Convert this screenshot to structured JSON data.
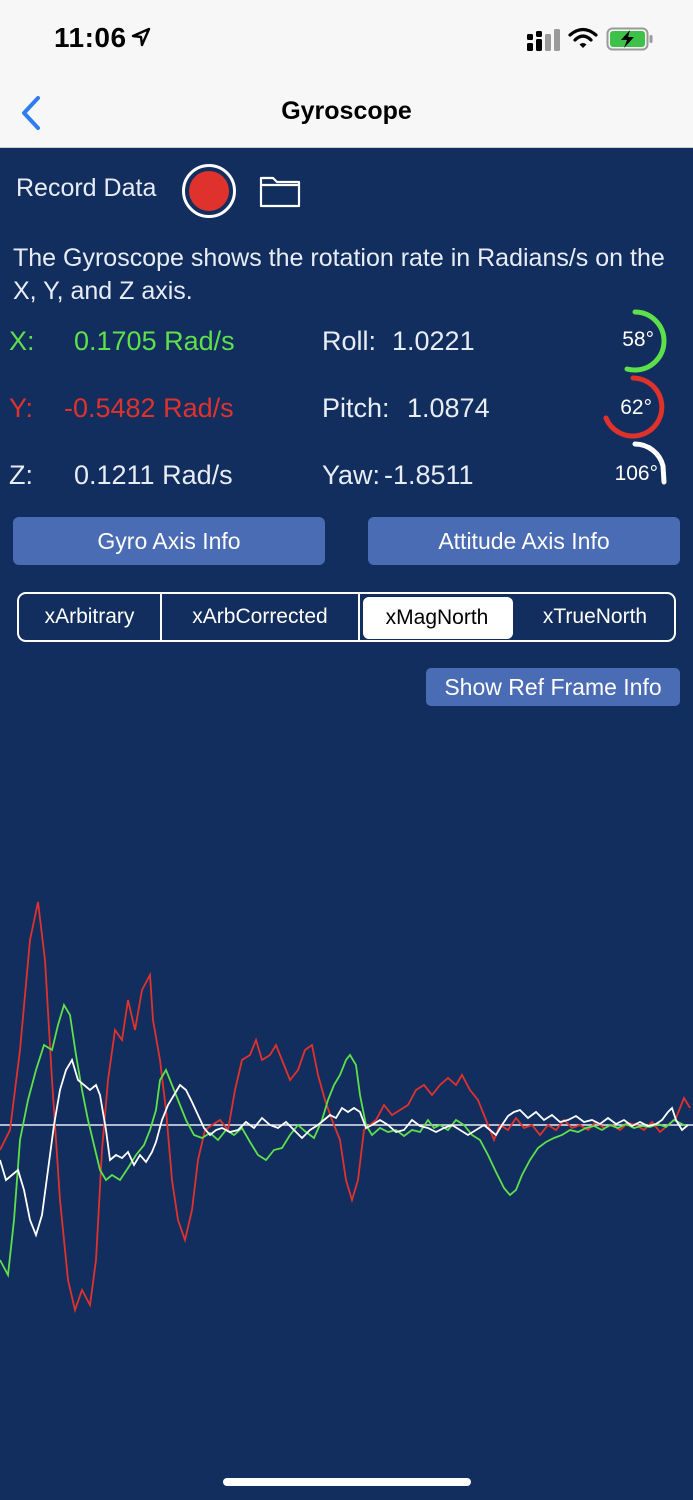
{
  "status": {
    "time": "11:06"
  },
  "nav": {
    "title": "Gyroscope"
  },
  "record": {
    "label": "Record Data"
  },
  "description": "The Gyroscope shows the rotation rate in Radians/s on the X, Y, and Z axis.",
  "rates": {
    "x": {
      "label": "X:",
      "value": "0.1705 Rad/s"
    },
    "y": {
      "label": "Y:",
      "value": "-0.5482 Rad/s"
    },
    "z": {
      "label": "Z:",
      "value": "0.1211 Rad/s"
    }
  },
  "attitude": {
    "roll": {
      "label": "Roll:",
      "value": "1.0221",
      "degrees": "58°"
    },
    "pitch": {
      "label": "Pitch:",
      "value": "1.0874",
      "degrees": "62°"
    },
    "yaw": {
      "label": "Yaw:",
      "value": "-1.8511",
      "degrees": "106°"
    }
  },
  "buttons": {
    "gyro_info": "Gyro Axis Info",
    "attitude_info": "Attitude Axis Info",
    "ref_frame_info": "Show Ref Frame Info"
  },
  "ref_frames": {
    "options": [
      "xArbitrary",
      "xArbCorrected",
      "xMagNorth",
      "xTrueNorth"
    ],
    "selected": "xMagNorth"
  },
  "colors": {
    "x_series": "#5ee04a",
    "y_series": "#e0322c",
    "z_series": "#ffffff",
    "background": "#122e5e",
    "button": "#4a6cb5"
  }
}
